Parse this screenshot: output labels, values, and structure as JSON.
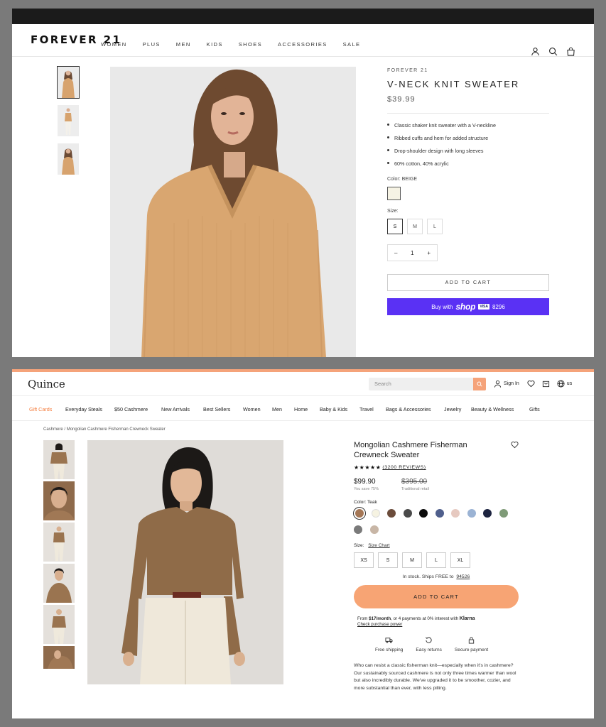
{
  "forever21": {
    "logo": "FOREVER 21",
    "nav": [
      "WOMEN",
      "PLUS",
      "MEN",
      "KIDS",
      "SHOES",
      "ACCESSORIES",
      "SALE"
    ],
    "product": {
      "brand": "FOREVER 21",
      "title": "V-NECK KNIT SWEATER",
      "price": "$39.99",
      "features": [
        "Classic shaker knit sweater with a V-neckline",
        "Ribbed cuffs and hem for added structure",
        "Drop-shoulder design with long sleeves",
        "60% cotton, 40% acrylic"
      ],
      "color_label": "Color: BEIGE",
      "size_label": "Size:",
      "sizes": [
        "S",
        "M",
        "L"
      ],
      "selected_size": "S",
      "qty_minus": "–",
      "quantity": "1",
      "qty_plus": "+",
      "add_to_cart": "ADD TO CART",
      "buy_with": "Buy with",
      "shop": "shop",
      "visa": "VISA",
      "card_last4": "8296"
    }
  },
  "quince": {
    "logo": "Quince",
    "search_placeholder": "Search",
    "sign_in": "Sign In",
    "region": "us",
    "categories": [
      "Gift Cards",
      "Everyday Steals",
      "$50 Cashmere",
      "New Arrivals",
      "Best Sellers",
      "Women",
      "Men",
      "Home",
      "Baby & Kids",
      "Travel",
      "Bags & Accessories",
      "Jewelry",
      "Beauty & Wellness",
      "Gifts"
    ],
    "breadcrumb": {
      "parent": "Cashmere",
      "sep": "/",
      "current": "Mongolian Cashmere Fisherman Crewneck Sweater"
    },
    "product": {
      "title": "Mongolian Cashmere Fisherman Crewneck Sweater",
      "stars": "★★★★★",
      "reviews": "(3200 REVIEWS)",
      "price": "$99.90",
      "savings": "You save 75%",
      "old_price": "$395.00",
      "old_price_label": "Traditional retail",
      "color_label": "Color: Teak",
      "size_label": "Size:",
      "size_chart": "Size Chart",
      "sizes": [
        "XS",
        "S",
        "M",
        "L",
        "XL"
      ],
      "stock_text": "In stock. Ships FREE to",
      "zip": "94526",
      "add_to_cart": "ADD TO CART",
      "klarna_from": "From",
      "klarna_amount": "$17/month",
      "klarna_rest": ", or 4 payments at 0% interest with",
      "klarna_brand": "Klarna",
      "klarna_link": "Check purchase power",
      "perks": [
        "Free shipping",
        "Easy returns",
        "Secure payment"
      ],
      "description": "Who can resist a classic fisherman knit—especially when it's in cashmere? Our sustainably sourced cashmere is not only three times warmer than wool but also incredibly durable. We've upgraded it to be smoother, cozier, and more substantial than ever, with less pilling."
    },
    "swatch_colors": [
      "#a47655",
      "#f6f3e2",
      "#6b4c3b",
      "#4a4a4a",
      "#0b0b0b",
      "#4f5f8c",
      "#e6c9c0",
      "#9bb3d4",
      "#1d2440",
      "#7f9b78",
      "#7a7a7a",
      "#c8b6a6"
    ]
  }
}
